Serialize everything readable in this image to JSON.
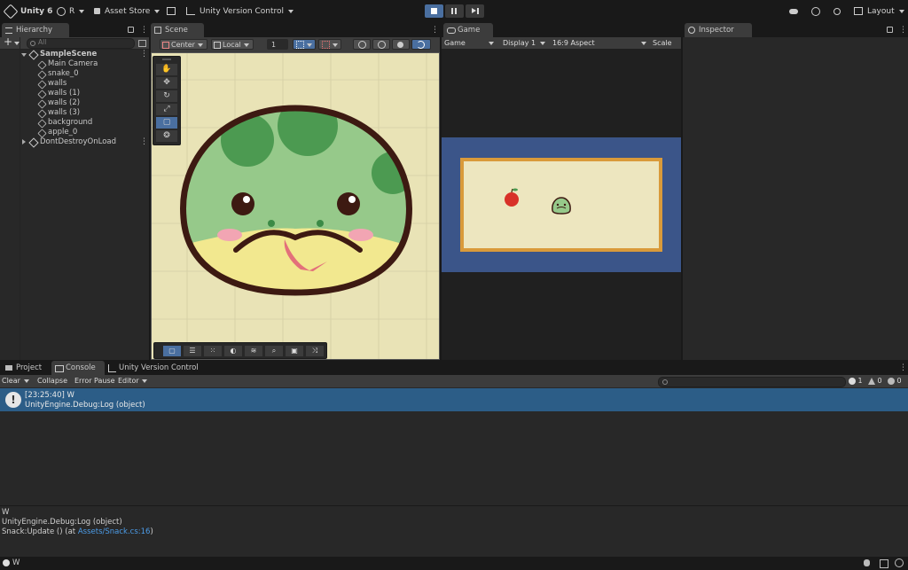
{
  "topbar": {
    "app": "Unity 6",
    "account": "R",
    "asset_store": "Asset Store",
    "version_control": "Unity Version Control",
    "layout": "Layout"
  },
  "hierarchy": {
    "tab": "Hierarchy",
    "search_placeholder": "All",
    "scene": "SampleScene",
    "items": [
      "Main Camera",
      "snake_0",
      "walls",
      "walls (1)",
      "walls (2)",
      "walls (3)",
      "background",
      "apple_0"
    ],
    "dont_destroy": "DontDestroyOnLoad"
  },
  "scene": {
    "tab": "Scene",
    "pivot_mode": "Center",
    "pivot_rotation": "Local",
    "grid_value": "1"
  },
  "game": {
    "tab": "Game",
    "mode": "Game",
    "display": "Display 1",
    "aspect": "16:9 Aspect",
    "scale_label": "Scale"
  },
  "inspector": {
    "tab": "Inspector"
  },
  "bottom_tabs": {
    "project": "Project",
    "console": "Console",
    "uvc": "Unity Version Control"
  },
  "console": {
    "clear": "Clear",
    "collapse": "Collapse",
    "error_pause": "Error Pause",
    "editor": "Editor",
    "count_log": "1",
    "count_warn": "0",
    "count_error": "0",
    "entry_line1": "[23:25:40] W",
    "entry_line2": "UnityEngine.Debug:Log (object)",
    "detail_line1": "W",
    "detail_line2": "UnityEngine.Debug:Log (object)",
    "detail_line3_prefix": "Snack:Update () (at ",
    "detail_link": "Assets/Snack.cs:16",
    "detail_line3_suffix": ")"
  },
  "statusbar": {
    "message": "W"
  },
  "colors": {
    "accent": "#4a6fa0",
    "selection": "#2c5d87",
    "scene_bg": "#e9e3b6",
    "game_bg": "#3b5589",
    "game_border": "#d99a3a",
    "snake_green": "#96c98a",
    "snake_outline": "#3d1a12",
    "link": "#4c9ce8"
  }
}
